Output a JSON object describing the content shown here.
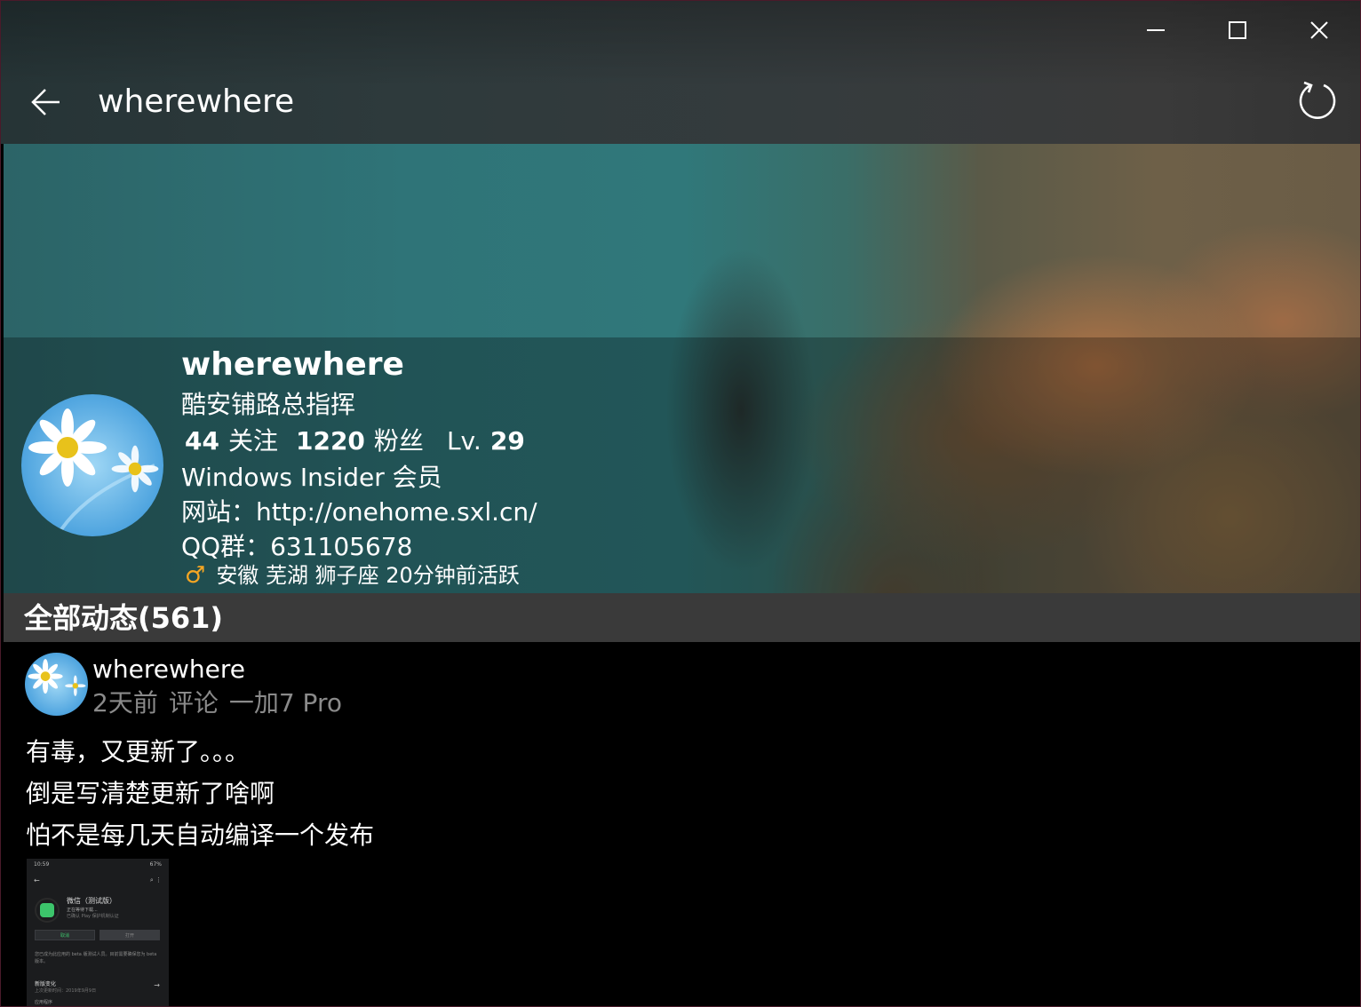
{
  "window": {
    "minimize_icon": "minimize-icon",
    "maximize_icon": "maximize-icon",
    "close_icon": "close-icon"
  },
  "header": {
    "title": "wherewhere",
    "back_icon": "arrow-left-icon",
    "refresh_icon": "refresh-icon"
  },
  "profile": {
    "name": "wherewhere",
    "bio": "酷安铺路总指挥",
    "following_count": "44",
    "following_label": "关注",
    "followers_count": "1220",
    "followers_label": "粉丝",
    "level_label": "Lv.",
    "level_value": "29",
    "membership": "Windows Insider 会员",
    "website": "网站：http://onehome.sxl.cn/",
    "qq_group": "QQ群：631105678",
    "gender_icon": "♂",
    "location": "安徽 芜湖",
    "zodiac": "狮子座",
    "last_active": "20分钟前活跃"
  },
  "feed": {
    "title": "全部动态(561)"
  },
  "post": {
    "author": "wherewhere",
    "time": "2天前",
    "type": "评论",
    "device": "一加7 Pro",
    "lines": [
      "有毒，又更新了。。。",
      "倒是写清楚更新了啥啊",
      "怕不是每几天自动编译一个发布"
    ],
    "thumbnail": {
      "status_time": "10:59",
      "status_right": "67%",
      "app_name": "微信（测试版）",
      "app_status": "正在等待下载...",
      "app_sub": "已确认 Play 保护机制认证",
      "btn_uninstall": "取消",
      "btn_open": "打开",
      "info": "您已成为此应用的 beta 版测试人员。目前需要确保您为 beta 版本。",
      "whats_new": "新版变化",
      "whats_new_sub": "上次更新时间：2019年9月9日",
      "more": "应用程序"
    }
  },
  "colors": {
    "section_header_bg": "#3a3a3a",
    "meta_text": "#8a8a8a",
    "gender_accent": "#f5a623",
    "wechat_green": "#3cc46b"
  }
}
